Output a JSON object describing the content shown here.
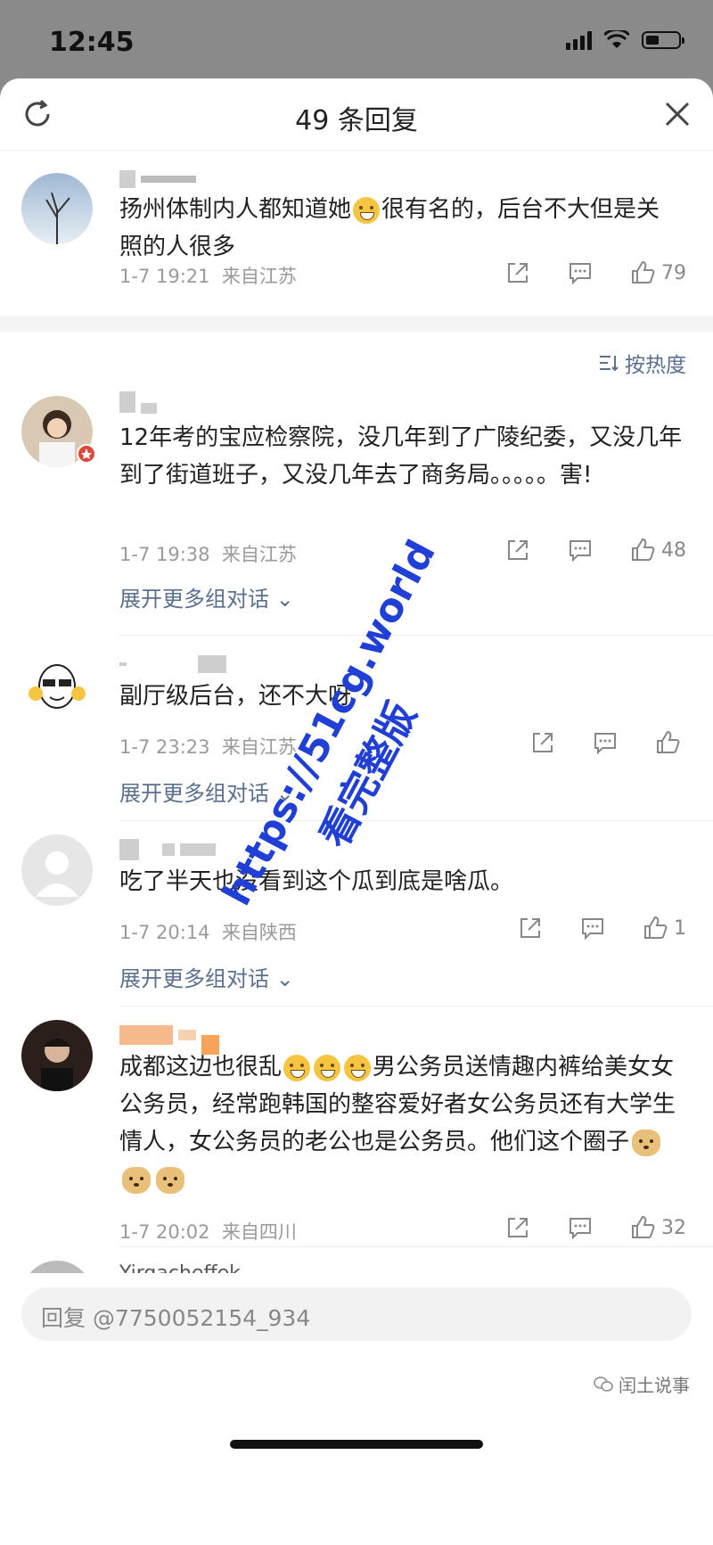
{
  "status_bar": {
    "time": "12:45"
  },
  "header": {
    "title": "49 条回复"
  },
  "sort": {
    "label": "按热度"
  },
  "comments": [
    {
      "text_a": "扬州体制内人都知道她",
      "text_b": "很有名的，后台不大但是关照的人很多",
      "time": "1-7 19:21",
      "location": "来自江苏",
      "likes": "79",
      "expand": ""
    },
    {
      "text": "12年考的宝应检察院，没几年到了广陵纪委，又没几年到了街道班子，又没几年去了商务局。。。。。害!",
      "time": "1-7 19:38",
      "location": "来自江苏",
      "likes": "48",
      "expand": "展开更多组对话"
    },
    {
      "text": "副厅级后台，还不大呀",
      "time": "1-7 23:23",
      "location": "来自江苏",
      "likes": "",
      "expand": "展开更多组对话"
    },
    {
      "text": "吃了半天也没看到这个瓜到底是啥瓜。",
      "time": "1-7 20:14",
      "location": "来自陕西",
      "likes": "1",
      "expand": "展开更多组对话"
    },
    {
      "text_a": "成都这边也很乱",
      "text_b": "男公务员送情趣内裤给美女女公务员，经常跑韩国的整容爱好者女公务员还有大学生情人，女公务员的老公也是公务员。他们这个圈子",
      "time": "1-7 20:02",
      "location": "来自四川",
      "likes": "32"
    }
  ],
  "next_user": "Yirgacheffek",
  "reply_input": {
    "placeholder": "回复 @7750052154_934"
  },
  "brand": "闰土说事",
  "watermark": {
    "line1": "https://51cg.world",
    "line2": "看完整版"
  },
  "colors": {
    "link": "#5b6f8e",
    "watermark": "#1f3fd6"
  }
}
